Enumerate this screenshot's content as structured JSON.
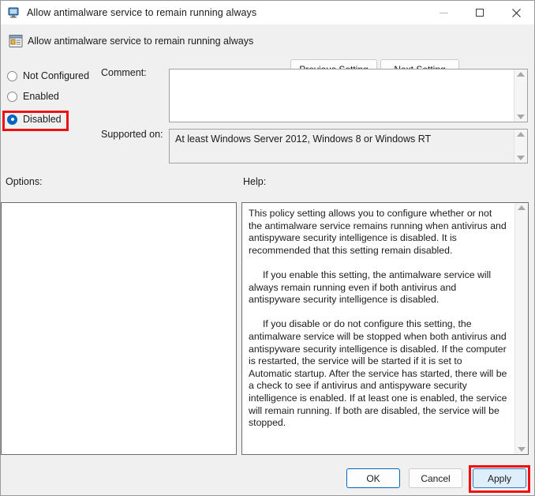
{
  "window": {
    "title": "Allow antimalware service to remain running always",
    "title_icon": "computer-monitor-icon",
    "controls": {
      "minimize": "minimize-icon",
      "maximize": "maximize-icon",
      "close": "close-icon"
    }
  },
  "header": {
    "icon": "policy-setting-icon",
    "title": "Allow antimalware service to remain running always",
    "previous_setting_label": "Previous Setting",
    "next_setting_label": "Next Setting"
  },
  "state_options": [
    {
      "label": "Not Configured",
      "selected": false
    },
    {
      "label": "Enabled",
      "selected": false
    },
    {
      "label": "Disabled",
      "selected": true
    }
  ],
  "fields": {
    "comment_label": "Comment:",
    "comment_value": "",
    "supported_on_label": "Supported on:",
    "supported_on_value": "At least Windows Server 2012, Windows 8 or Windows RT"
  },
  "panels": {
    "options_label": "Options:",
    "options_content": "",
    "help_label": "Help:",
    "help_paragraphs": [
      "This policy setting allows you to configure whether or not the antimalware service remains running when antivirus and antispyware security intelligence is disabled. It is recommended that this setting remain disabled.",
      "If you enable this setting, the antimalware service will always remain running even if both antivirus and antispyware security intelligence is disabled.",
      "If you disable or do not configure this setting, the antimalware service will be stopped when both antivirus and antispyware security intelligence is disabled. If the computer is restarted, the service will be started if it is set to Automatic startup. After the service has started, there will be a check to see if antivirus and antispyware security intelligence is enabled. If at least one is enabled, the service will remain running. If both are disabled, the service will be stopped."
    ]
  },
  "footer": {
    "ok_label": "OK",
    "cancel_label": "Cancel",
    "apply_label": "Apply"
  },
  "colors": {
    "accent": "#0067c0",
    "highlight": "#ee1111",
    "apply_fill": "#dfeefb",
    "window_background": "#f0f0f0"
  }
}
